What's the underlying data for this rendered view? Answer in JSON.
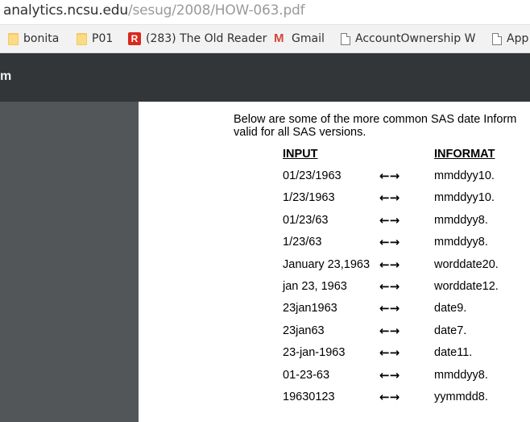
{
  "address_bar": {
    "host": "analytics.ncsu.edu",
    "path": "/sesug/2008/HOW-063.pdf"
  },
  "bookmarks": [
    {
      "label": "bonita",
      "icon": "folder-icon"
    },
    {
      "label": "P01",
      "icon": "folder-icon"
    },
    {
      "label": "(283) The Old Reader",
      "icon": "old-reader-icon"
    },
    {
      "label": "Gmail",
      "icon": "gmail-icon"
    },
    {
      "label_visible": "AccountOwnership W",
      "label_faded": "...",
      "icon": "page-icon"
    },
    {
      "label": "App",
      "icon": "page-icon"
    }
  ],
  "toolbar": {
    "title_fragment": "m"
  },
  "document": {
    "intro_line1": "Below are some of the more common SAS date Inform",
    "intro_line2": "valid for all SAS versions.",
    "headers": {
      "input": "INPUT",
      "informat": "INFORMAT"
    },
    "arrow": "←→",
    "rows": [
      {
        "input": "01/23/1963",
        "informat": "mmddyy10."
      },
      {
        "input": "1/23/1963",
        "informat": "mmddyy10."
      },
      {
        "input": "01/23/63",
        "informat": "mmddyy8."
      },
      {
        "input": "1/23/63",
        "informat": "mmddyy8."
      },
      {
        "input": "January 23,1963",
        "informat": "worddate20."
      },
      {
        "input": "jan 23, 1963",
        "informat": "worddate12."
      },
      {
        "input": "23jan1963",
        "informat": "date9."
      },
      {
        "input": "23jan63",
        "informat": "date7."
      },
      {
        "input": "23-jan-1963",
        "informat": "date11."
      },
      {
        "input": "01-23-63",
        "informat": "mmddyy8."
      },
      {
        "input": "19630123",
        "informat": "yymmdd8."
      }
    ]
  },
  "colors": {
    "toolbar_bg": "#323639",
    "viewer_bg": "#525659",
    "bookmarks_bg": "#f2f2f2"
  }
}
